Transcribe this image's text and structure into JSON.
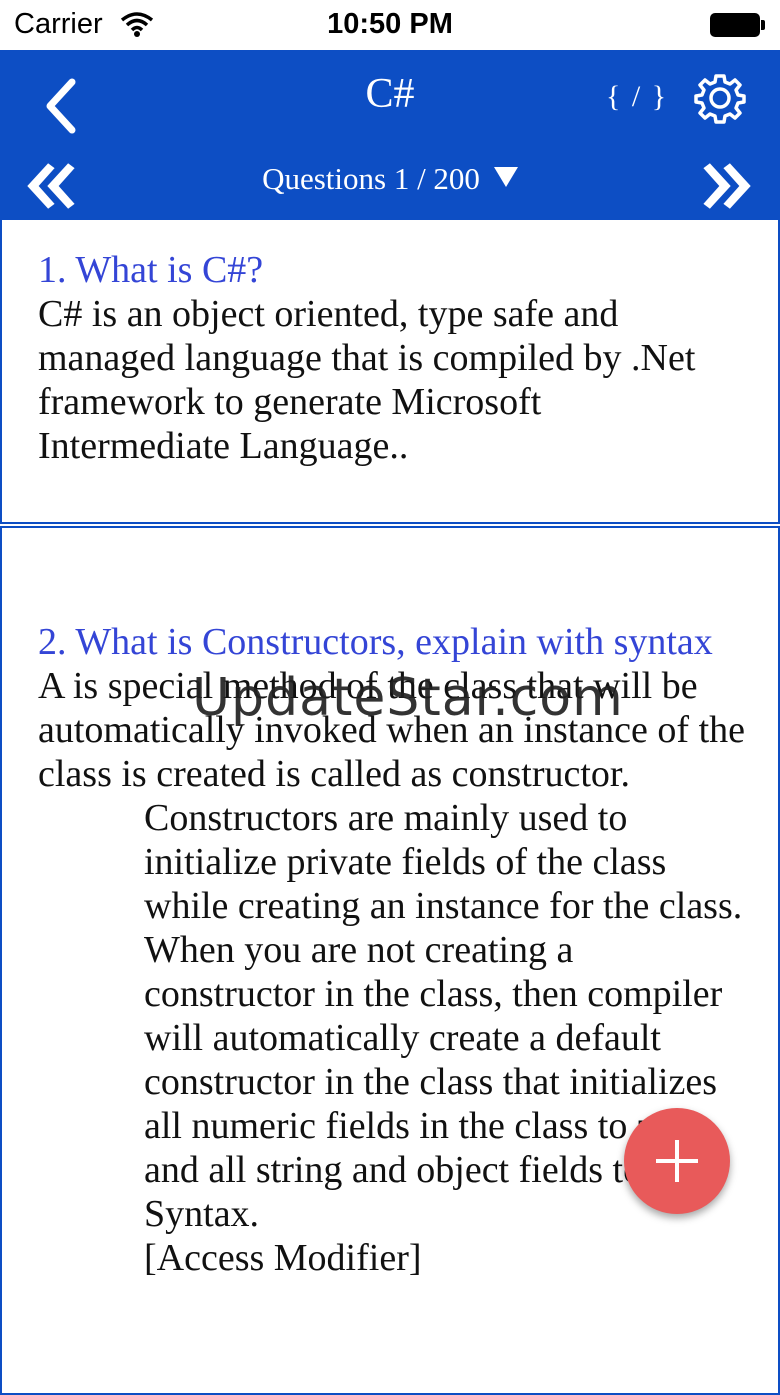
{
  "status_bar": {
    "carrier": "Carrier",
    "time": "10:50 PM"
  },
  "nav": {
    "title": "C#",
    "code_toggle": "{ / }",
    "counter": "Questions 1 / 200",
    "icons": [
      "back-chevron-icon",
      "code-icon",
      "gear-icon",
      "double-chevron-left-icon",
      "dropdown-caret-icon",
      "double-chevron-right-icon"
    ],
    "accent_color": "#0d4ec4"
  },
  "questions": [
    {
      "title": "1. What is C#?",
      "body": [
        "C# is an object oriented, type safe and managed language that is compiled by .Net framework to generate Microsoft Intermediate Language.."
      ]
    },
    {
      "title": "2. What is Constructors, explain with syntax",
      "body": [
        "A is special method of the class that will be automatically invoked when an instance of the class is created is called as constructor.",
        "Constructors are mainly used to initialize private fields of the class while creating an instance for the class.",
        "When you are not creating a constructor in the class, then compiler will automatically create a default constructor in the class that initializes all numeric fields in the class to zero and all string and object fields to null.",
        "Syntax.",
        "[Access Modifier]"
      ]
    }
  ],
  "watermark": "UpdateStar.com",
  "fab": {
    "icon": "plus-icon",
    "color": "#e85a5a"
  },
  "title_color": "#3445d6"
}
